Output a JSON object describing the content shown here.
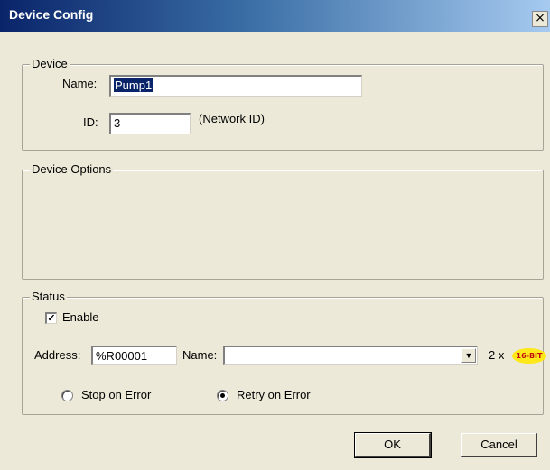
{
  "window": {
    "title": "Device Config",
    "close_glyph": "×"
  },
  "device": {
    "group_label": "Device",
    "name_label": "Name:",
    "name_value": "Pump1",
    "id_label": "ID:",
    "id_value": "3",
    "id_hint": "(Network ID)"
  },
  "device_options": {
    "group_label": "Device Options"
  },
  "status": {
    "group_label": "Status",
    "enable_label": "Enable",
    "enable_checked": true,
    "check_glyph": "✓",
    "address_label": "Address:",
    "address_value": "%R00001",
    "name_label": "Name:",
    "name_value": "",
    "dropdown_glyph": "▼",
    "multiplier": "2 x",
    "bit_badge": "16-BIT",
    "stop_on_error_label": "Stop on Error",
    "retry_on_error_label": "Retry on Error",
    "selected_error_mode": "retry"
  },
  "buttons": {
    "ok": "OK",
    "cancel": "Cancel"
  }
}
